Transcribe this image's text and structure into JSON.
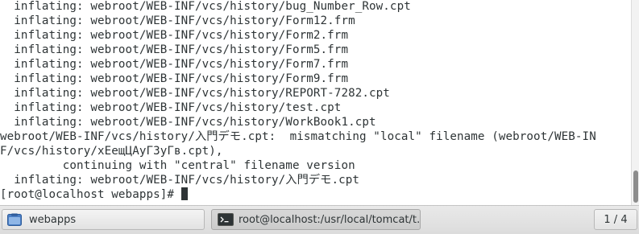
{
  "terminal": {
    "lines": [
      "  inflating: webroot/WEB-INF/vcs/history/bug_Number_Row.cpt",
      "  inflating: webroot/WEB-INF/vcs/history/Form12.frm",
      "  inflating: webroot/WEB-INF/vcs/history/Form2.frm",
      "  inflating: webroot/WEB-INF/vcs/history/Form5.frm",
      "  inflating: webroot/WEB-INF/vcs/history/Form7.frm",
      "  inflating: webroot/WEB-INF/vcs/history/Form9.frm",
      "  inflating: webroot/WEB-INF/vcs/history/REPORT-7282.cpt",
      "  inflating: webroot/WEB-INF/vcs/history/test.cpt",
      "  inflating: webroot/WEB-INF/vcs/history/WorkBook1.cpt",
      "webroot/WEB-INF/vcs/history/入門デモ.cpt:  mismatching \"local\" filename (webroot/WEB-IN",
      "F/vcs/history/хЕещЦАуГЗуГв.cpt),",
      "         continuing with \"central\" filename version",
      "  inflating: webroot/WEB-INF/vcs/history/入門デモ.cpt"
    ],
    "prompt": "[root@localhost webapps]# "
  },
  "taskbar": {
    "task1_label": "webapps",
    "task2_label": "root@localhost:/usr/local/tomcat/t…",
    "pager_label": "1 / 4"
  },
  "icons": {
    "task1": "folder-icon",
    "task2": "terminal-icon"
  }
}
